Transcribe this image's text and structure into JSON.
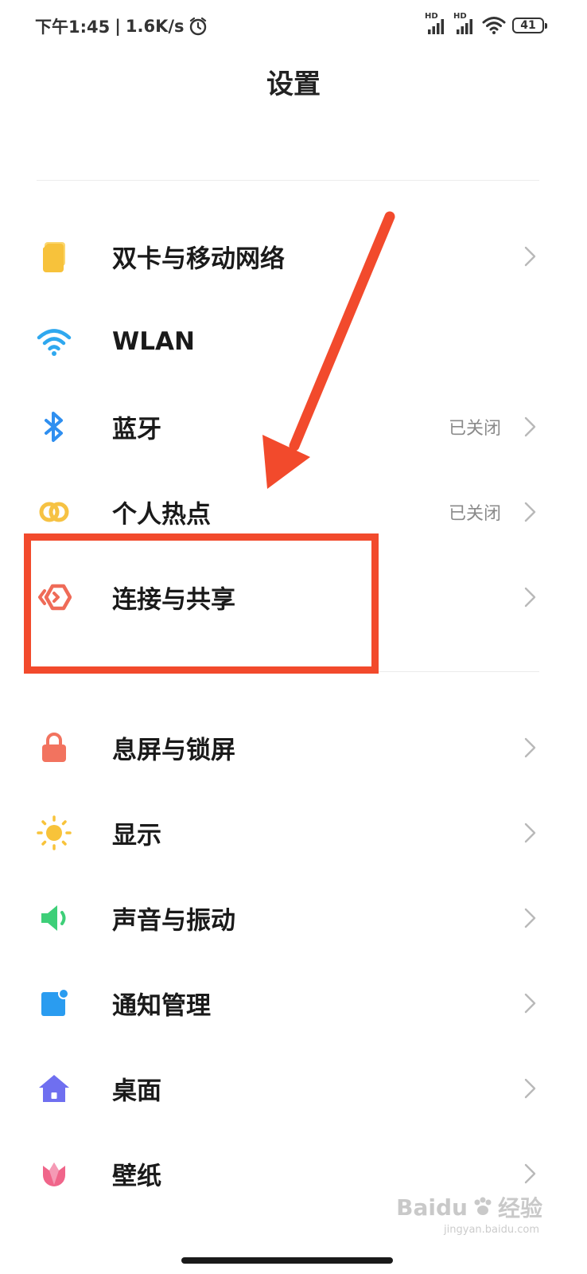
{
  "status_bar": {
    "time": "下午1:45",
    "separator": "|",
    "net_speed": "1.6K/s",
    "sim1_label": "HD",
    "sim2_label": "HD",
    "battery": "41",
    "icons": [
      "alarm-icon",
      "signal-icon",
      "signal-icon",
      "wifi-icon",
      "battery-icon"
    ]
  },
  "header": {
    "title": "设置"
  },
  "groups": [
    {
      "items": [
        {
          "label": "双卡与移动网络",
          "value": "",
          "icon": "sim-card-icon",
          "color": "#f7c23b"
        },
        {
          "label": "WLAN",
          "value": "",
          "icon": "wifi-icon",
          "color": "#2fa8ef"
        },
        {
          "label": "蓝牙",
          "value": "已关闭",
          "icon": "bluetooth-icon",
          "color": "#2f8ff0"
        },
        {
          "label": "个人热点",
          "value": "已关闭",
          "icon": "hotspot-icon",
          "color": "#f6c243"
        },
        {
          "label": "连接与共享",
          "value": "",
          "icon": "connection-share-icon",
          "color": "#ef6b58"
        }
      ]
    },
    {
      "items": [
        {
          "label": "息屏与锁屏",
          "value": "",
          "icon": "lock-icon",
          "color": "#f2735f"
        },
        {
          "label": "显示",
          "value": "",
          "icon": "sun-icon",
          "color": "#f8c33a"
        },
        {
          "label": "声音与振动",
          "value": "",
          "icon": "speaker-icon",
          "color": "#3ecf78"
        },
        {
          "label": "通知管理",
          "value": "",
          "icon": "notification-icon",
          "color": "#2a9cf0"
        },
        {
          "label": "桌面",
          "value": "",
          "icon": "home-icon",
          "color": "#6f6ff0"
        },
        {
          "label": "壁纸",
          "value": "",
          "icon": "tulip-icon",
          "color": "#f0658a"
        }
      ]
    }
  ],
  "annotation": {
    "color": "#f24a2c"
  },
  "watermark": {
    "brand": "Baidu",
    "suffix": "经验",
    "url": "jingyan.baidu.com"
  }
}
